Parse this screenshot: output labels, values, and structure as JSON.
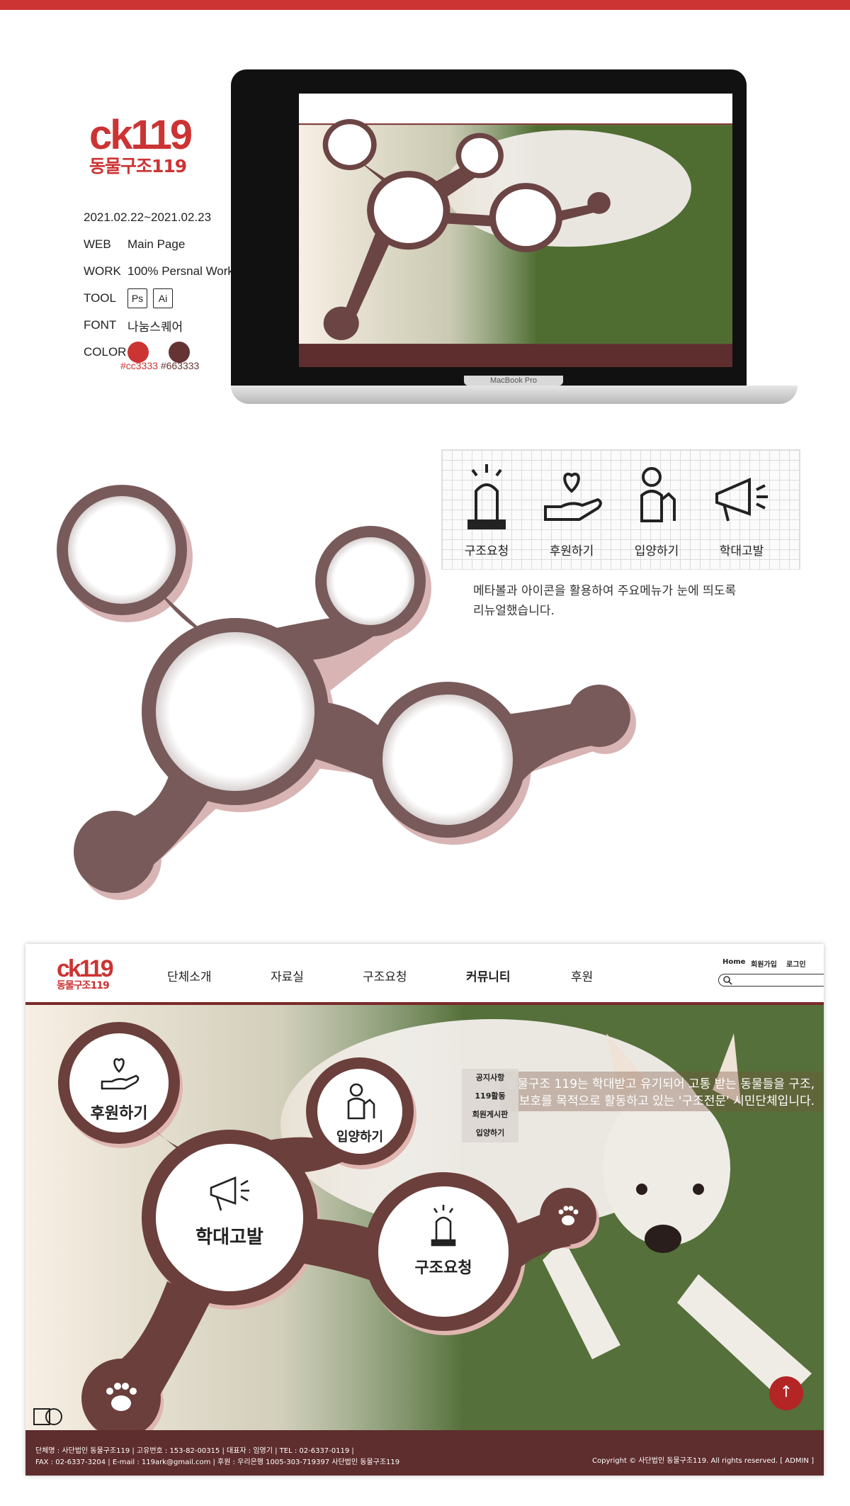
{
  "brand": {
    "logo_text": "ck119",
    "logo_korean": "동물구조119",
    "accent": "#cc3333",
    "secondary": "#663333"
  },
  "project": {
    "date": "2021.02.22~2021.02.23",
    "web_label": "WEB",
    "web_value": "Main Page",
    "work_label": "WORK",
    "work_value": "100% Persnal Work",
    "tool_label": "TOOL",
    "tools": [
      "Ps",
      "Ai"
    ],
    "font_label": "FONT",
    "font_value": "나눔스퀘어",
    "color_label": "COLOR",
    "colors": [
      "#cc3333",
      "#663333"
    ]
  },
  "laptop": {
    "model": "MacBook Pro"
  },
  "nav": {
    "items": [
      "단체소개",
      "자료실",
      "구조요청",
      "커뮤니티",
      "후원"
    ],
    "active": "커뮤니티",
    "top_links": [
      "Home",
      "회원가입",
      "로그인"
    ]
  },
  "dropdown": {
    "items": [
      "공지사항",
      "119활동",
      "회원게시판",
      "입양하기"
    ]
  },
  "hero": {
    "tagline_1": "동물구조 119는 학대받고 유기되어 고통 받는 동물들을 구조,",
    "tagline_2": "보호를 목적으로 활동하고 있는 '구조전문' 시민단체입니다."
  },
  "menu": {
    "donate": "후원하기",
    "adopt": "입양하기",
    "report": "학대고발",
    "rescue": "구조요청"
  },
  "icon_panel": {
    "items": [
      "구조요청",
      "후원하기",
      "입양하기",
      "학대고발"
    ],
    "description_1": "메타볼과 아이콘을 활용하여 주요메뉴가 눈에 띄도록",
    "description_2": "리뉴얼했습니다."
  },
  "footer": {
    "line1": "단체명 : 사단법인 동물구조119  |  고유번호 : 153-82-00315  |  대표자 : 임영기  |  TEL : 02-6337-0119  |",
    "line2": "FAX : 02-6337-3204  |  E-mail : 119ark@gmail.com  |  후원 : 우리은행 1005-303-719397 사단법인 동물구조119",
    "copyright": "Copyright © 사단법인 동물구조119.  All rights reserved.  [ ADMIN ]"
  },
  "to_top": "↑"
}
